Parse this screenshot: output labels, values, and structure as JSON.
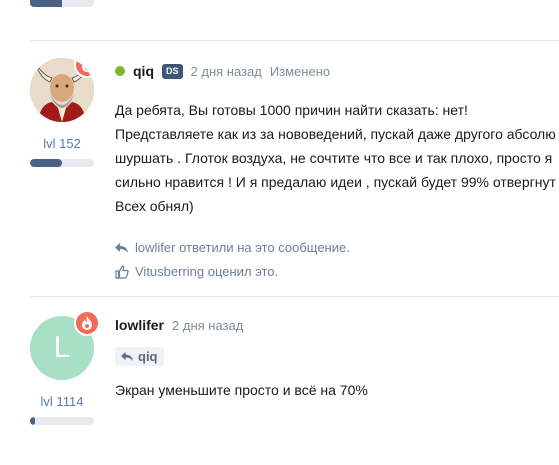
{
  "post1": {
    "username": "qiq",
    "badge": "DS",
    "time": "2 дня назад",
    "edited": "Изменено",
    "level": "lvl 152",
    "xp_progress": 0.5,
    "lines": [
      "Да ребята, Вы готовы 1000 причин найти сказать: нет!",
      "Представляете как из за нововедений, пускай даже другого абсолю",
      "шуршать . Глоток воздуха, не сочтите что все и так плохо, просто я",
      "сильно нравится ! И я предалаю идеи , пускай будет 99% отвергнут",
      "Всех обнял)"
    ],
    "reply_note": "lowlifer ответили на это сообщение.",
    "like_note": "Vitusberring оценил это."
  },
  "post2": {
    "avatar_letter": "L",
    "username": "lowlifer",
    "time": "2 дня назад",
    "level": "lvl 1114",
    "xp_progress": 0.08,
    "quote_user": "qiq",
    "text": "Экран уменьшите просто и всё на 70%"
  },
  "top_xp_progress": 0.5,
  "colors": {
    "accent": "#4a6285",
    "online": "#7cb82f",
    "fire": "#f26b5b",
    "avatar_l": "#a8e0c6"
  }
}
